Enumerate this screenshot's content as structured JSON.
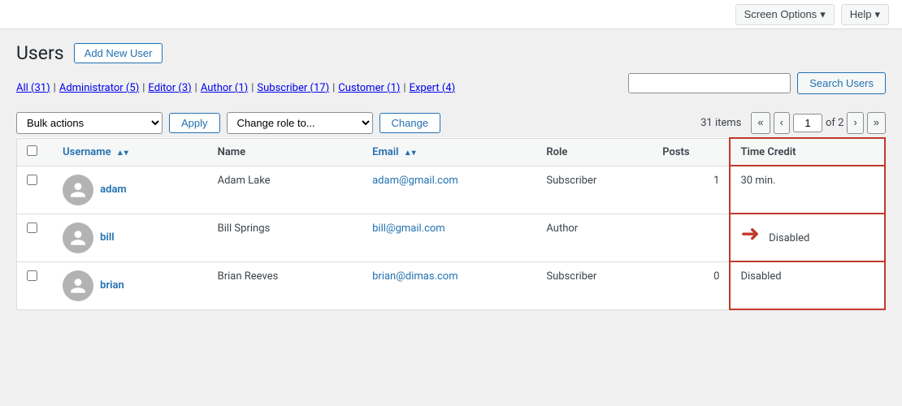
{
  "topbar": {
    "screen_options_label": "Screen Options",
    "help_label": "Help"
  },
  "page": {
    "title": "Users",
    "add_new_label": "Add New User"
  },
  "filter": {
    "all_label": "All",
    "all_count": "31",
    "administrator_label": "Administrator",
    "administrator_count": "5",
    "editor_label": "Editor",
    "editor_count": "3",
    "author_label": "Author",
    "author_count": "1",
    "subscriber_label": "Subscriber",
    "subscriber_count": "17",
    "customer_label": "Customer",
    "customer_count": "1",
    "expert_label": "Expert",
    "expert_count": "4"
  },
  "search": {
    "placeholder": "",
    "button_label": "Search Users"
  },
  "actions": {
    "bulk_default": "Bulk actions",
    "apply_label": "Apply",
    "role_default": "Change role to...",
    "change_label": "Change",
    "items_count": "31 items",
    "page_current": "1",
    "page_of": "of 2"
  },
  "table": {
    "columns": {
      "username": "Username",
      "name": "Name",
      "email": "Email",
      "role": "Role",
      "posts": "Posts",
      "time_credit": "Time Credit"
    },
    "rows": [
      {
        "username": "adam",
        "name": "Adam Lake",
        "email": "adam@gmail.com",
        "role": "Subscriber",
        "posts": "1",
        "time_credit": "30 min.",
        "has_arrow": false
      },
      {
        "username": "bill",
        "name": "Bill Springs",
        "email": "bill@gmail.com",
        "role": "Author",
        "posts": "",
        "time_credit": "Disabled",
        "has_arrow": true
      },
      {
        "username": "brian",
        "name": "Brian Reeves",
        "email": "brian@dimas.com",
        "role": "Subscriber",
        "posts": "0",
        "time_credit": "Disabled",
        "has_arrow": false
      }
    ]
  }
}
